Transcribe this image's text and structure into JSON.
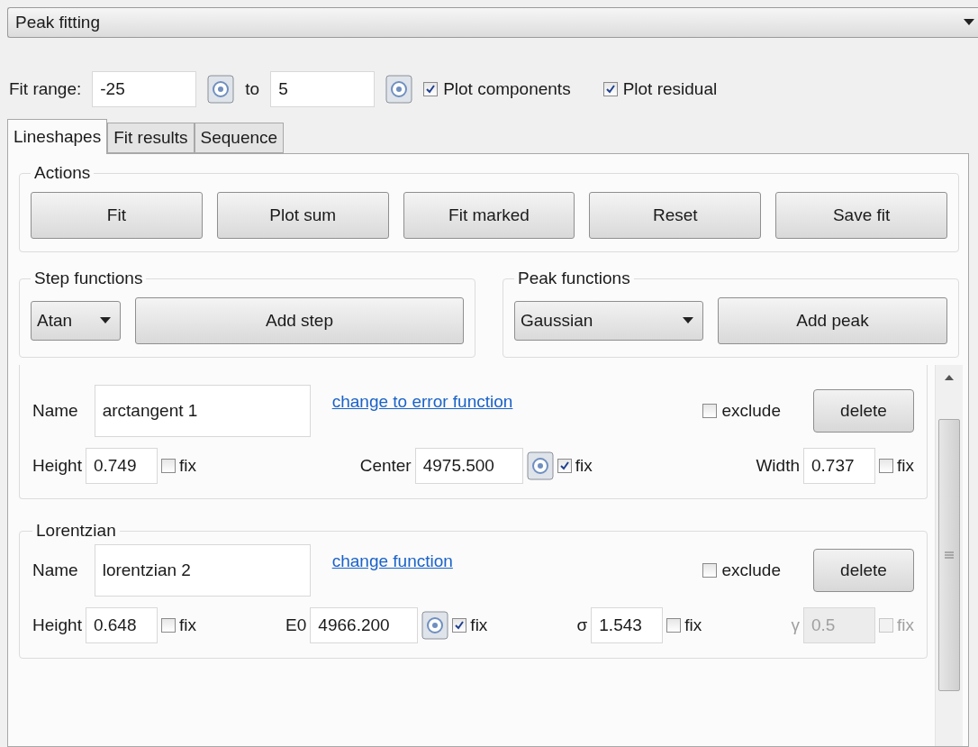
{
  "mode_select": {
    "value": "Peak fitting"
  },
  "fit_range": {
    "label": "Fit range:",
    "from": "-25",
    "to_label": "to",
    "to": "5",
    "options": [
      {
        "label": "Plot components",
        "checked": true
      },
      {
        "label": "Plot residual",
        "checked": true
      }
    ]
  },
  "tabs": [
    {
      "label": "Lineshapes",
      "selected": true
    },
    {
      "label": "Fit results",
      "selected": false
    },
    {
      "label": "Sequence",
      "selected": false
    }
  ],
  "actions": {
    "title": "Actions",
    "buttons": [
      "Fit",
      "Plot sum",
      "Fit marked",
      "Reset",
      "Save fit"
    ]
  },
  "step_functions": {
    "title": "Step functions",
    "select": "Atan",
    "button": "Add step"
  },
  "peak_functions": {
    "title": "Peak functions",
    "select": "Gaussian",
    "button": "Add peak"
  },
  "components": [
    {
      "name_label": "Name",
      "name": "arctangent 1",
      "link": "change to error function",
      "exclude": {
        "label": "exclude",
        "checked": false
      },
      "delete": "delete",
      "params": [
        {
          "label": "Height",
          "value": "0.749",
          "picker": false,
          "fix_label": "fix",
          "fixed": false,
          "disabled": false
        },
        {
          "label": "Center",
          "value": "4975.500",
          "picker": true,
          "fix_label": "fix",
          "fixed": true,
          "disabled": false
        },
        {
          "label": "Width",
          "value": "0.737",
          "picker": false,
          "fix_label": "fix",
          "fixed": false,
          "disabled": false
        }
      ]
    },
    {
      "title": "Lorentzian",
      "name_label": "Name",
      "name": "lorentzian 2",
      "link": "change function",
      "exclude": {
        "label": "exclude",
        "checked": false
      },
      "delete": "delete",
      "params": [
        {
          "label": "Height",
          "value": "0.648",
          "picker": false,
          "fix_label": "fix",
          "fixed": false,
          "disabled": false
        },
        {
          "label": "E0",
          "value": "4966.200",
          "picker": true,
          "fix_label": "fix",
          "fixed": true,
          "disabled": false
        },
        {
          "label": "σ",
          "value": "1.543",
          "picker": false,
          "fix_label": "fix",
          "fixed": false,
          "disabled": false
        },
        {
          "label": "γ",
          "value": "0.5",
          "picker": false,
          "fix_label": "fix",
          "fixed": false,
          "disabled": true
        }
      ]
    }
  ]
}
